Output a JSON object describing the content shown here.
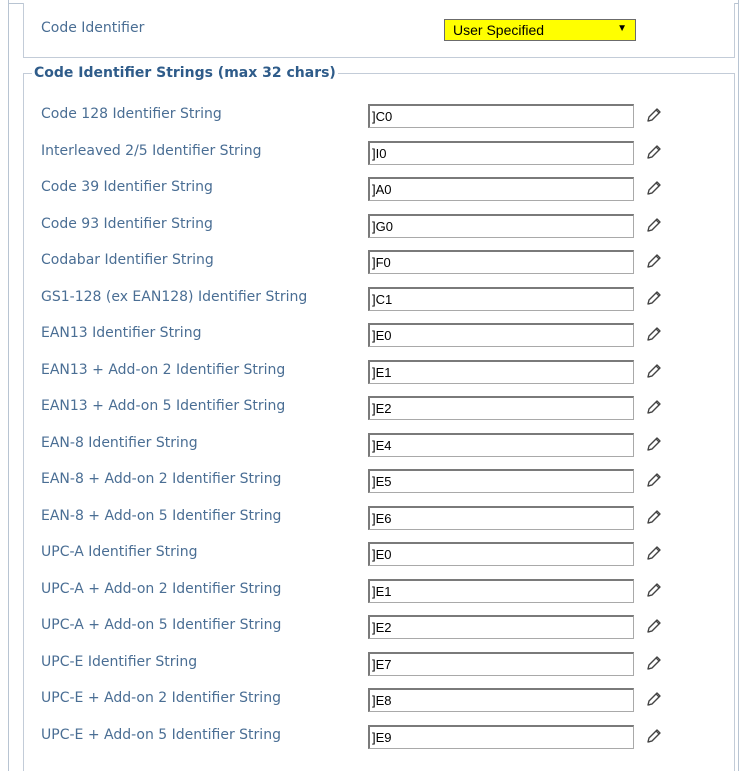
{
  "top": {
    "label": "Code Identifier",
    "select_value": "User Specified",
    "select_arrow": "▼"
  },
  "group": {
    "legend": "Code Identifier Strings (max 32 chars)",
    "rows": [
      {
        "label": "Code 128 Identifier String",
        "value": "]C0"
      },
      {
        "label": "Interleaved 2/5 Identifier String",
        "value": "]I0"
      },
      {
        "label": "Code 39 Identifier String",
        "value": "]A0"
      },
      {
        "label": "Code 93 Identifier String",
        "value": "]G0"
      },
      {
        "label": "Codabar Identifier String",
        "value": "]F0"
      },
      {
        "label": "GS1-128 (ex EAN128) Identifier String",
        "value": "]C1"
      },
      {
        "label": "EAN13 Identifier String",
        "value": "]E0"
      },
      {
        "label": "EAN13 + Add-on 2 Identifier String",
        "value": "]E1"
      },
      {
        "label": "EAN13 + Add-on 5 Identifier String",
        "value": "]E2"
      },
      {
        "label": "EAN-8 Identifier String",
        "value": "]E4"
      },
      {
        "label": "EAN-8 + Add-on 2 Identifier String",
        "value": "]E5"
      },
      {
        "label": "EAN-8 + Add-on 5 Identifier String",
        "value": "]E6"
      },
      {
        "label": "UPC-A Identifier String",
        "value": "]E0"
      },
      {
        "label": "UPC-A + Add-on 2 Identifier String",
        "value": "]E1"
      },
      {
        "label": "UPC-A + Add-on 5 Identifier String",
        "value": "]E2"
      },
      {
        "label": "UPC-E Identifier String",
        "value": "]E7"
      },
      {
        "label": "UPC-E + Add-on 2 Identifier String",
        "value": "]E8"
      },
      {
        "label": "UPC-E + Add-on 5 Identifier String",
        "value": "]E9"
      }
    ]
  },
  "icons": {
    "edit": "pencil-icon"
  },
  "colors": {
    "label": "#4a6e94",
    "legend": "#2f5c8a",
    "select_bg": "#ffff00"
  }
}
